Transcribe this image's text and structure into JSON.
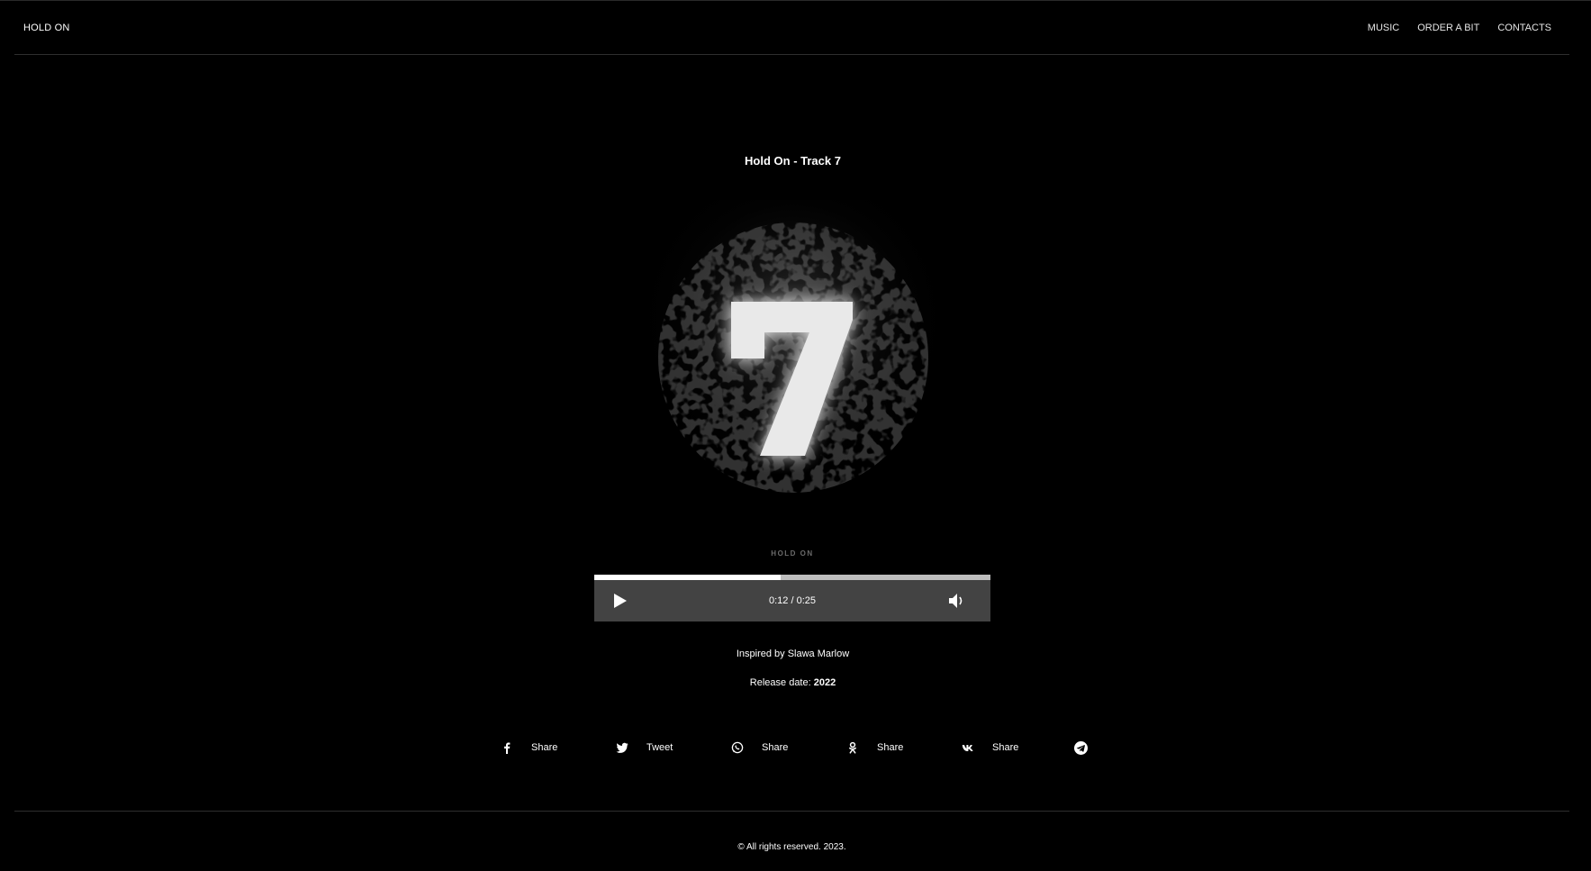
{
  "header": {
    "logo": "HOLD ON",
    "nav": [
      "MUSIC",
      "ORDER A BIT",
      "CONTACTS"
    ]
  },
  "track": {
    "title": "Hold On - Track 7",
    "cover_text": "HOLD ON",
    "cover_number": "7"
  },
  "player": {
    "time_current": "0:12",
    "time_separator": "/",
    "time_total": "0:25",
    "progress": 0.47
  },
  "info": {
    "inspired": "Inspired by Slawa Marlow",
    "release_label": "Release date:",
    "release_year": "2022"
  },
  "share": [
    {
      "icon": "facebook-icon",
      "label": "Share"
    },
    {
      "icon": "twitter-icon",
      "label": "Tweet"
    },
    {
      "icon": "whatsapp-icon",
      "label": "Share"
    },
    {
      "icon": "odnoklassniki-icon",
      "label": "Share"
    },
    {
      "icon": "vk-icon",
      "label": "Share"
    },
    {
      "icon": "telegram-icon",
      "label": ""
    }
  ],
  "footer": {
    "copyright": "© All rights reserved. 2023."
  },
  "colors": {
    "background": "#000000",
    "player_bg": "#434343",
    "progress_track": "#bdbdbd",
    "progress_fill": "#ffffff"
  }
}
